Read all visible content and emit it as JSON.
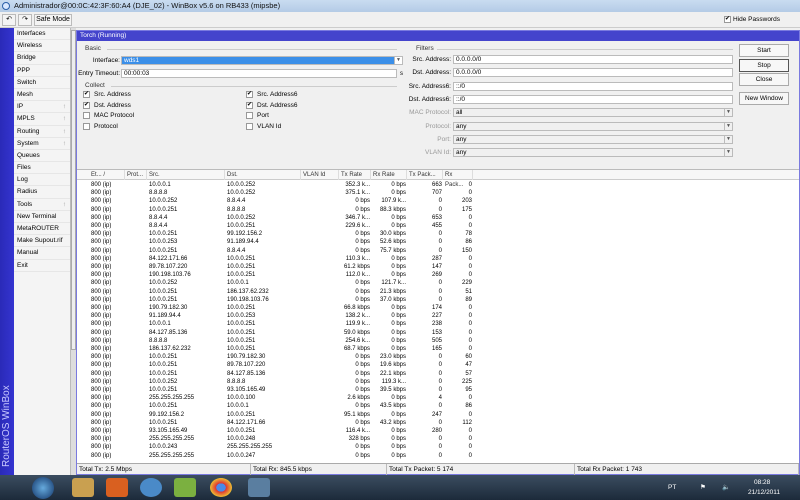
{
  "window": {
    "title": "Administrador@00:0C:42:3F:60:A4 (DJE_02) - WinBox v5.6 on RB433 (mipsbe)"
  },
  "toolbar": {
    "undo": "↶",
    "redo": "↷",
    "safe_mode": "Safe Mode",
    "hide_passwords": "Hide Passwords",
    "hide_passwords_checked": true
  },
  "sidebar": {
    "brand": "RouterOS WinBox",
    "items": [
      {
        "label": "Interfaces"
      },
      {
        "label": "Wireless"
      },
      {
        "label": "Bridge"
      },
      {
        "label": "PPP"
      },
      {
        "label": "Switch"
      },
      {
        "label": "Mesh"
      },
      {
        "label": "IP",
        "submenu": true
      },
      {
        "label": "MPLS",
        "submenu": true
      },
      {
        "label": "Routing",
        "submenu": true
      },
      {
        "label": "System",
        "submenu": true
      },
      {
        "label": "Queues"
      },
      {
        "label": "Files"
      },
      {
        "label": "Log"
      },
      {
        "label": "Radius"
      },
      {
        "label": "Tools",
        "submenu": true
      },
      {
        "label": "New Terminal"
      },
      {
        "label": "MetaROUTER"
      },
      {
        "label": "Make Supout.rif"
      },
      {
        "label": "Manual"
      },
      {
        "label": "Exit"
      }
    ]
  },
  "torch": {
    "title": "Torch (Running)",
    "basic": {
      "heading": "Basic",
      "interface_label": "Interface:",
      "interface_value": "wds1",
      "timeout_label": "Entry Timeout:",
      "timeout_value": "00:00:03",
      "timeout_unit": "s"
    },
    "collect": {
      "heading": "Collect",
      "items": [
        {
          "label": "Src. Address",
          "checked": true
        },
        {
          "label": "Dst. Address",
          "checked": true
        },
        {
          "label": "MAC Protocol",
          "checked": false
        },
        {
          "label": "Protocol",
          "checked": false
        },
        {
          "label": "Src. Address6",
          "checked": true
        },
        {
          "label": "Dst. Address6",
          "checked": true
        },
        {
          "label": "Port",
          "checked": false
        },
        {
          "label": "VLAN Id",
          "checked": false
        }
      ]
    },
    "filters": {
      "heading": "Filters",
      "fields": [
        {
          "label": "Src. Address:",
          "value": "0.0.0.0/0",
          "enabled": true
        },
        {
          "label": "Dst. Address:",
          "value": "0.0.0.0/0",
          "enabled": true
        },
        {
          "label": "Src. Address6:",
          "value": "::/0",
          "enabled": true
        },
        {
          "label": "Dst. Address6:",
          "value": "::/0",
          "enabled": true
        },
        {
          "label": "MAC Protocol:",
          "value": "all",
          "enabled": false
        },
        {
          "label": "Protocol:",
          "value": "any",
          "enabled": false
        },
        {
          "label": "Port:",
          "value": "any",
          "enabled": false
        },
        {
          "label": "VLAN Id:",
          "value": "any",
          "enabled": false
        }
      ]
    },
    "buttons": {
      "start": "Start",
      "stop": "Stop",
      "close": "Close",
      "new_window": "New Window"
    },
    "table": {
      "columns": [
        "Et... /",
        "Prot...",
        "Src.",
        "Dst.",
        "VLAN Id",
        "Tx Rate",
        "Rx Rate",
        "Tx Pack...",
        "Rx Pack..."
      ],
      "rows": [
        [
          "800 (ip)",
          "",
          "10.0.0.1",
          "10.0.0.252",
          "",
          "352.3 k...",
          "0 bps",
          "663",
          "0"
        ],
        [
          "800 (ip)",
          "",
          "8.8.8.8",
          "10.0.0.252",
          "",
          "375.1 k...",
          "0 bps",
          "707",
          "0"
        ],
        [
          "800 (ip)",
          "",
          "10.0.0.252",
          "8.8.4.4",
          "",
          "0 bps",
          "107.9 k...",
          "0",
          "203"
        ],
        [
          "800 (ip)",
          "",
          "10.0.0.251",
          "8.8.8.8",
          "",
          "0 bps",
          "88.3 kbps",
          "0",
          "175"
        ],
        [
          "800 (ip)",
          "",
          "8.8.4.4",
          "10.0.0.252",
          "",
          "346.7 k...",
          "0 bps",
          "653",
          "0"
        ],
        [
          "800 (ip)",
          "",
          "8.8.4.4",
          "10.0.0.251",
          "",
          "229.6 k...",
          "0 bps",
          "455",
          "0"
        ],
        [
          "800 (ip)",
          "",
          "10.0.0.251",
          "99.192.156.2",
          "",
          "0 bps",
          "30.0 kbps",
          "0",
          "78"
        ],
        [
          "800 (ip)",
          "",
          "10.0.0.253",
          "91.189.94.4",
          "",
          "0 bps",
          "52.6 kbps",
          "0",
          "86"
        ],
        [
          "800 (ip)",
          "",
          "10.0.0.251",
          "8.8.4.4",
          "",
          "0 bps",
          "75.7 kbps",
          "0",
          "150"
        ],
        [
          "800 (ip)",
          "",
          "84.122.171.66",
          "10.0.0.251",
          "",
          "110.3 k...",
          "0 bps",
          "287",
          "0"
        ],
        [
          "800 (ip)",
          "",
          "89.78.107.220",
          "10.0.0.251",
          "",
          "61.2 kbps",
          "0 bps",
          "147",
          "0"
        ],
        [
          "800 (ip)",
          "",
          "190.198.103.76",
          "10.0.0.251",
          "",
          "112.0 k...",
          "0 bps",
          "269",
          "0"
        ],
        [
          "800 (ip)",
          "",
          "10.0.0.252",
          "10.0.0.1",
          "",
          "0 bps",
          "121.7 k...",
          "0",
          "229"
        ],
        [
          "800 (ip)",
          "",
          "10.0.0.251",
          "186.137.62.232",
          "",
          "0 bps",
          "21.3 kbps",
          "0",
          "51"
        ],
        [
          "800 (ip)",
          "",
          "10.0.0.251",
          "190.198.103.76",
          "",
          "0 bps",
          "37.0 kbps",
          "0",
          "89"
        ],
        [
          "800 (ip)",
          "",
          "190.79.182.30",
          "10.0.0.251",
          "",
          "66.8 kbps",
          "0 bps",
          "174",
          "0"
        ],
        [
          "800 (ip)",
          "",
          "91.189.94.4",
          "10.0.0.253",
          "",
          "138.2 k...",
          "0 bps",
          "227",
          "0"
        ],
        [
          "800 (ip)",
          "",
          "10.0.0.1",
          "10.0.0.251",
          "",
          "119.9 k...",
          "0 bps",
          "238",
          "0"
        ],
        [
          "800 (ip)",
          "",
          "84.127.85.136",
          "10.0.0.251",
          "",
          "59.0 kbps",
          "0 bps",
          "153",
          "0"
        ],
        [
          "800 (ip)",
          "",
          "8.8.8.8",
          "10.0.0.251",
          "",
          "254.6 k...",
          "0 bps",
          "505",
          "0"
        ],
        [
          "800 (ip)",
          "",
          "186.137.62.232",
          "10.0.0.251",
          "",
          "68.7 kbps",
          "0 bps",
          "165",
          "0"
        ],
        [
          "800 (ip)",
          "",
          "10.0.0.251",
          "190.79.182.30",
          "",
          "0 bps",
          "23.0 kbps",
          "0",
          "60"
        ],
        [
          "800 (ip)",
          "",
          "10.0.0.251",
          "89.78.107.220",
          "",
          "0 bps",
          "19.6 kbps",
          "0",
          "47"
        ],
        [
          "800 (ip)",
          "",
          "10.0.0.251",
          "84.127.85.136",
          "",
          "0 bps",
          "22.1 kbps",
          "0",
          "57"
        ],
        [
          "800 (ip)",
          "",
          "10.0.0.252",
          "8.8.8.8",
          "",
          "0 bps",
          "119.3 k...",
          "0",
          "225"
        ],
        [
          "800 (ip)",
          "",
          "10.0.0.251",
          "93.105.165.49",
          "",
          "0 bps",
          "39.5 kbps",
          "0",
          "95"
        ],
        [
          "800 (ip)",
          "",
          "255.255.255.255",
          "10.0.0.100",
          "",
          "2.6 kbps",
          "0 bps",
          "4",
          "0"
        ],
        [
          "800 (ip)",
          "",
          "10.0.0.251",
          "10.0.0.1",
          "",
          "0 bps",
          "43.5 kbps",
          "0",
          "86"
        ],
        [
          "800 (ip)",
          "",
          "99.192.156.2",
          "10.0.0.251",
          "",
          "95.1 kbps",
          "0 bps",
          "247",
          "0"
        ],
        [
          "800 (ip)",
          "",
          "10.0.0.251",
          "84.122.171.66",
          "",
          "0 bps",
          "43.2 kbps",
          "0",
          "112"
        ],
        [
          "800 (ip)",
          "",
          "93.105.165.49",
          "10.0.0.251",
          "",
          "116.4 k...",
          "0 bps",
          "280",
          "0"
        ],
        [
          "800 (ip)",
          "",
          "255.255.255.255",
          "10.0.0.248",
          "",
          "328 bps",
          "0 bps",
          "0",
          "0"
        ],
        [
          "800 (ip)",
          "",
          "10.0.0.243",
          "255.255.255.255",
          "",
          "0 bps",
          "0 bps",
          "0",
          "0"
        ],
        [
          "800 (ip)",
          "",
          "255.255.255.255",
          "10.0.0.247",
          "",
          "0 bps",
          "0 bps",
          "0",
          "0"
        ]
      ]
    },
    "footer": {
      "total_tx": "Total Tx: 2.5 Mbps",
      "total_rx": "Total Rx: 845.5 kbps",
      "total_tx_packet": "Total Tx Packet: 5 174",
      "total_rx_packet": "Total Rx Packet: 1 743"
    }
  },
  "taskbar": {
    "language": "PT",
    "time": "08:28",
    "date": "21/12/2011"
  }
}
